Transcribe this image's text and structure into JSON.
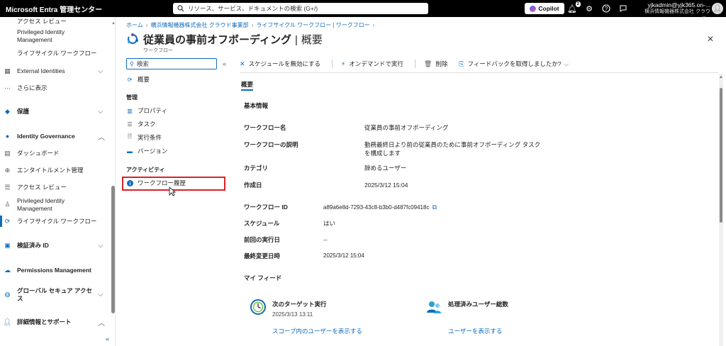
{
  "topbar": {
    "brand": "Microsoft Entra 管理センター",
    "search_placeholder": "リソース、サービス、ドキュメントの検索 (G+/)",
    "copilot_label": "Copilot",
    "notification_count": "2",
    "account_user": "yjkadmin@yjk365.on-...",
    "account_tenant": "横浜情報機器株式会社 クラウド..."
  },
  "leftnav": {
    "items": [
      {
        "label": "アクセス レビュー",
        "icon": "checklist-icon"
      },
      {
        "label": "Privileged Identity",
        "label2": "Management",
        "icon": "pim-icon"
      },
      {
        "label": "ライフサイクル ワークフロー",
        "icon": "lifecycle-icon"
      },
      {
        "label": "External Identities",
        "icon": "external-identities-icon"
      },
      {
        "label": "さらに表示",
        "icon": "more-icon"
      },
      {
        "label": "保護",
        "icon": "protection-icon"
      },
      {
        "label": "Identity Governance",
        "icon": "governance-icon"
      },
      {
        "label": "ダッシュボード",
        "icon": "dashboard-icon"
      },
      {
        "label": "エンタイトルメント管理",
        "icon": "entitlement-icon"
      },
      {
        "label": "アクセス レビュー",
        "icon": "checklist-icon"
      },
      {
        "label": "Privileged Identity",
        "label2": "Management",
        "icon": "pim-icon"
      },
      {
        "label": "ライフサイクル ワークフロー",
        "icon": "lifecycle-icon"
      },
      {
        "label": "検証済み ID",
        "icon": "verified-id-icon"
      },
      {
        "label": "Permissions Management",
        "icon": "cloud-icon"
      },
      {
        "label": "グローバル セキュア アクセス",
        "icon": "globe-icon"
      },
      {
        "label": "詳細情報とサポート",
        "icon": "person-icon"
      }
    ],
    "collapse_glyph": "«"
  },
  "breadcrumb": [
    "ホーム",
    "横浜情報機器株式会社 クラウド事業部",
    "ライフサイクル ワークフロー | ワークフロー"
  ],
  "header": {
    "title": "従業員の事前オフボーディング",
    "section": "概要",
    "subtitle": "ワークフロー"
  },
  "resmenu": {
    "search_placeholder": "検索",
    "overview": "概要",
    "manage_header": "管理",
    "manage_items": [
      "プロパティ",
      "タスク",
      "実行条件",
      "バージョン"
    ],
    "activity_header": "アクティビティ",
    "activity_items": [
      "ワークフロー履歴"
    ]
  },
  "toolbar": {
    "disable_schedule": "スケジュールを無効にする",
    "run_on_demand": "オンデマンドで実行",
    "delete": "削除",
    "feedback": "フィードバックを取得しましたか?"
  },
  "overview": {
    "tab": "概要",
    "basic_info": "基本情報",
    "props": [
      {
        "k": "ワークフロー名",
        "v": "従業員の事前オフボーディング"
      },
      {
        "k": "ワークフローの説明",
        "v": "勤務最終日より前の従業員のために事前オフボーディング タスク",
        "v2": "を構成します"
      },
      {
        "k": "カテゴリ",
        "v": "辞めるユーザー"
      },
      {
        "k": "作成日",
        "v": "2025/3/12 15:04"
      }
    ],
    "props2": [
      {
        "k": "ワークフロー ID",
        "v": "a89a6e8d-7293-43c8-b3b0-d487fc09418c"
      },
      {
        "k": "スケジュール",
        "v": "はい"
      },
      {
        "k": "前回の実行日",
        "v": "--"
      },
      {
        "k": "最終変更日時",
        "v": "2025/3/12 15:04"
      }
    ],
    "feed_header": "マイ フィード",
    "cards": [
      {
        "title": "次のターゲット実行",
        "value": "2025/3/13 13:11",
        "link": "スコープ内のユーザーを表示する",
        "icon": "clock-icon"
      },
      {
        "title": "処理済みユーザー総数",
        "value": "",
        "link": "ユーザーを表示する",
        "icon": "users-icon"
      }
    ]
  },
  "colors": {
    "accent": "#0f6cbd",
    "highlight": "#d8232a",
    "topbar": "#000000"
  }
}
